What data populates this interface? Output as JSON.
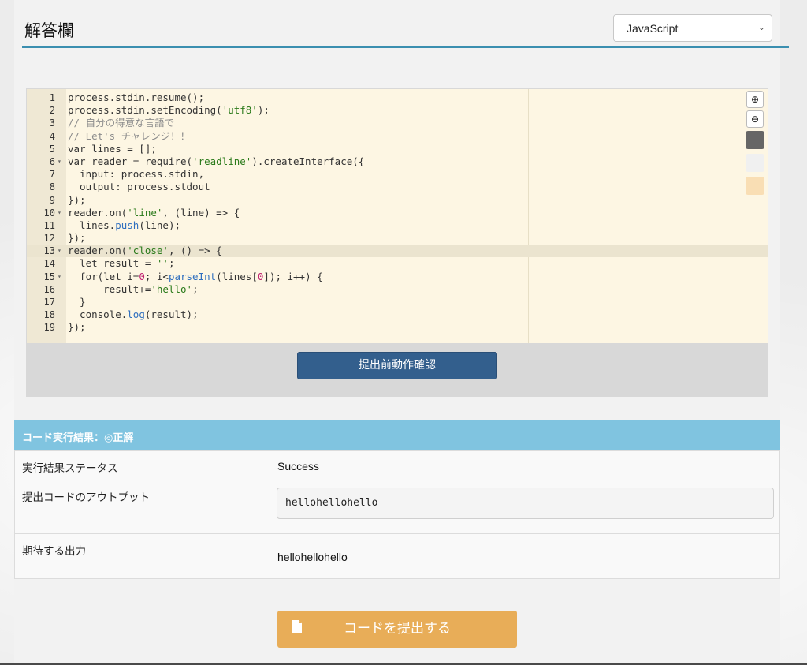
{
  "header": {
    "title": "解答欄",
    "language": "JavaScript"
  },
  "editor": {
    "lines": [
      {
        "n": "1",
        "fold": "",
        "html": "process.stdin.resume();"
      },
      {
        "n": "2",
        "fold": "",
        "html": "process.stdin.setEncoding(<span class='str'>'utf8'</span>);"
      },
      {
        "n": "3",
        "fold": "",
        "html": "<span class='cmt'>// 自分の得意な言語で</span>"
      },
      {
        "n": "4",
        "fold": "",
        "html": "<span class='cmt'>// Let's チャレンジ！！</span>"
      },
      {
        "n": "5",
        "fold": "",
        "html": "var lines = [];"
      },
      {
        "n": "6",
        "fold": "▾",
        "html": "var reader = require(<span class='str'>'readline'</span>).createInterface({"
      },
      {
        "n": "7",
        "fold": "",
        "html": "  input: process.stdin,"
      },
      {
        "n": "8",
        "fold": "",
        "html": "  output: process.stdout"
      },
      {
        "n": "9",
        "fold": "",
        "html": "});"
      },
      {
        "n": "10",
        "fold": "▾",
        "html": "reader.on(<span class='str'>'line'</span>, (line) => {"
      },
      {
        "n": "11",
        "fold": "",
        "html": "  lines.<span class='fn'>push</span>(line);"
      },
      {
        "n": "12",
        "fold": "",
        "html": "});"
      },
      {
        "n": "13",
        "fold": "▾",
        "html": "reader.on(<span class='str'>'close'</span>, () => {"
      },
      {
        "n": "14",
        "fold": "",
        "html": "  let result = <span class='str'>''</span>;"
      },
      {
        "n": "15",
        "fold": "▾",
        "html": "  for(let i=<span class='num'>0</span>; i<<span class='fn'>parseInt</span>(lines[<span class='num'>0</span>]); i++) {"
      },
      {
        "n": "16",
        "fold": "",
        "html": "      result+=<span class='str'>'hello'</span>;"
      },
      {
        "n": "17",
        "fold": "",
        "html": "  }"
      },
      {
        "n": "18",
        "fold": "",
        "html": "  console.<span class='fn'>log</span>(result);"
      },
      {
        "n": "19",
        "fold": "",
        "html": "});"
      }
    ],
    "active_line": 13,
    "tools": {
      "zoom_in": "⊕",
      "zoom_out": "⊖"
    },
    "swatches": [
      "#666666",
      "#f0f0f0",
      "#f9deb4"
    ]
  },
  "check_button": "提出前動作確認",
  "result": {
    "heading": "コード実行結果：◎正解",
    "rows": [
      {
        "label": "実行結果ステータス",
        "value": "Success"
      },
      {
        "label": "提出コードのアウトプット",
        "value": "hellohellohello"
      },
      {
        "label": "期待する出力",
        "value": "hellohellohello"
      }
    ]
  },
  "submit_button": "コードを提出する",
  "colors": {
    "accent": "#3b8fb0",
    "result_header": "#80c4e0",
    "submit": "#e8ad58",
    "check": "#335f8d"
  }
}
